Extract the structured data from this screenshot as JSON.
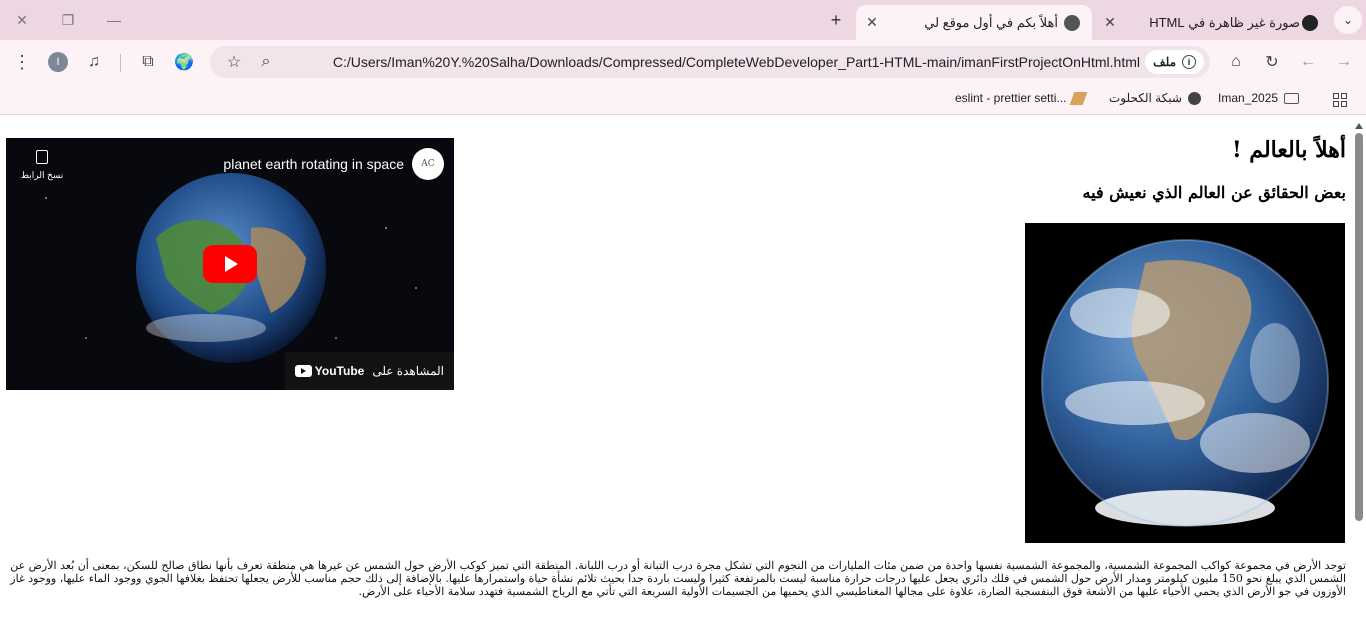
{
  "tabs": [
    {
      "title": "صورة غير ظاهرة في HTML",
      "active": false
    },
    {
      "title": "أهلاً بكم في أول موقع لي",
      "active": true
    }
  ],
  "toolbar": {
    "url": "C:/Users/Iman%20Y.%20Salha/Downloads/Compressed/CompleteWebDeveloper_Part1-HTML-main/imanFirstProjectOnHtml.html",
    "site_chip_label": "ملف",
    "profile_initial": "I"
  },
  "bookmarks": [
    {
      "label": "Iman_2025",
      "icon": "folder-icon"
    },
    {
      "label": "شبكة الكحلوت",
      "icon": "globe-icon"
    },
    {
      "label": "eslint - prettier setti...",
      "icon": "pen-icon"
    }
  ],
  "page": {
    "heading": "أهلاً بالعالم !",
    "subheading": "بعض الحقائق عن العالم الذي نعيش فيه",
    "image_alt": "Earth",
    "paragraph": "توجد الأرض في مجموعة كواكب المجموعة الشمسية، والمجموعة الشمسية نفسها واحدة من ضمن مئات المليارات من النجوم التي تشكل مجرة درب التبانة أو درب اللبانة. المنطقة التي تميز كوكب الأرض حول الشمس عن غيرها هي منطقة تعرف بأنها نطاق صالح للسكن، بمعنى أن بُعد الأرض عن الشمس الذي يبلغ نحو 150 مليون كيلومتر ومدار الأرض حول الشمس في فلك دائري يجعل عليها درجات حرارة مناسبة ليست بالمرتفعة كثيرا وليست باردة جدا بحيث تلائم نشأة حياة واستمرارها عليها. بالإضافة إلى ذلك حجم مناسب للأرض يجعلها تحتفظ بغلافها الجوي ووجود الماء عليها، ووجود غاز الأوزون في جو الأرض الذي يحمي الأحياء عليها من الأشعة فوق البنفسجية الضارة، علاوة على مجالها المغناطيسي الذي يحميها من الجسيمات الأولية السريعة التي تأتي مع الرياح الشمسية فتهدد سلامة الأحياء على الأرض."
  },
  "video": {
    "title": "planet earth rotating in space",
    "channel_logo_text": "AC",
    "copy_link_label": "نسخ الرابط",
    "watch_on_label": "المشاهدة على",
    "youtube_label": "YouTube"
  },
  "colors": {
    "tabstrip": "#ecd7e3",
    "toolbar": "#fdf3f7",
    "youtube_red": "#ff0000"
  }
}
